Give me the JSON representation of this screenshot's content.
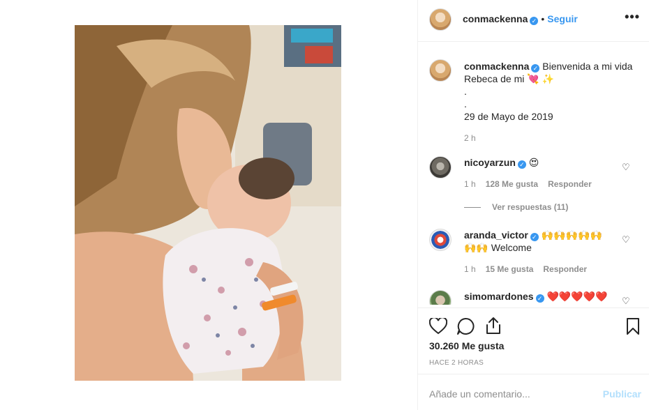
{
  "header": {
    "username": "conmackenna",
    "verified_glyph": "✓",
    "follow_label": "Seguir",
    "separator": "•",
    "more_label": "•••"
  },
  "caption": {
    "username": "conmackenna",
    "text_line1": "Bienvenida a mi vida",
    "text_line2": "Rebeca de mi",
    "emoji1": "💘",
    "emoji2": "✨",
    "dot1": ".",
    "dot2": ".",
    "date": "29 de Mayo de 2019",
    "time": "2 h"
  },
  "comments": [
    {
      "username": "nicoyarzun",
      "text": "😍",
      "time": "1 h",
      "likes": "128 Me gusta",
      "reply_label": "Responder",
      "view_replies": "Ver respuestas (11)"
    },
    {
      "username": "aranda_victor",
      "text_line1": "🙌🙌🙌🙌🙌",
      "text_line2_emoji": "🙌🙌",
      "text_line2": "Welcome",
      "time": "1 h",
      "likes": "15 Me gusta",
      "reply_label": "Responder"
    },
    {
      "username": "simomardones",
      "text": "❤️❤️❤️❤️❤️"
    }
  ],
  "actions": {
    "likes": "30.260 Me gusta",
    "ago": "HACE 2 HORAS"
  },
  "add_comment": {
    "placeholder": "Añade un comentario...",
    "publish_label": "Publicar"
  },
  "colors": {
    "accent": "#3897f0",
    "muted": "#8e8e8e",
    "publish_disabled": "#b2dffc"
  }
}
